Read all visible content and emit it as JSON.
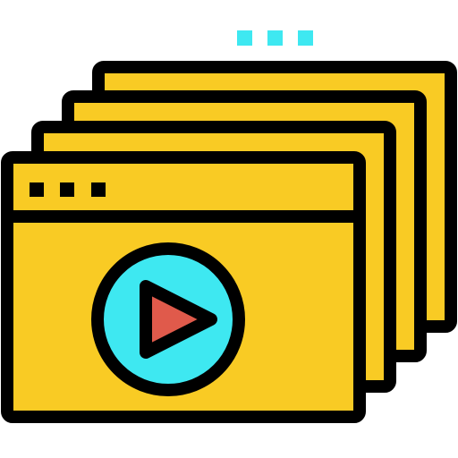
{
  "icon": {
    "name": "video-stack-icon",
    "colors": {
      "outline": "#000000",
      "window_fill": "#F9CB24",
      "accent_cyan": "#3EE8F1",
      "play_triangle": "#E05A4B",
      "background": "#FFFFFF"
    },
    "window_count": 4,
    "decorative_dot_count": 3,
    "titlebar_dot_count": 3,
    "play_button": {
      "icon": "play-icon"
    }
  }
}
